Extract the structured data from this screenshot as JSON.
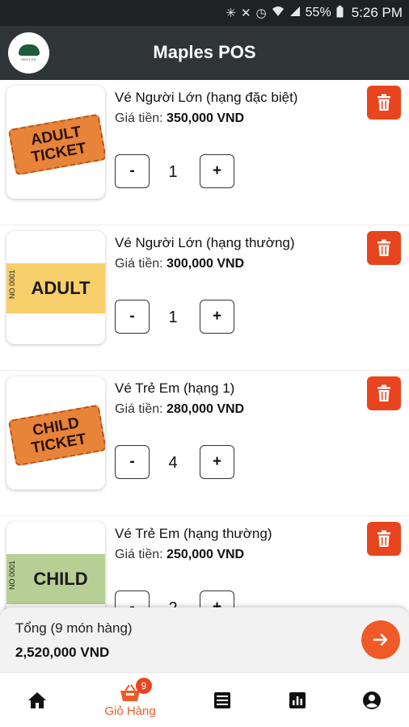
{
  "status_bar": {
    "battery": "55%",
    "time": "5:26 PM",
    "icons": [
      "bluetooth-icon",
      "mute-icon",
      "alarm-icon",
      "wifi-icon",
      "signal-icon",
      "battery-icon"
    ]
  },
  "header": {
    "title": "Maples POS",
    "logo": "maples-logo"
  },
  "cart": {
    "price_prefix": "Giá tiền:",
    "items": [
      {
        "name": "Vé Người Lớn (hạng đặc biệt)",
        "price": "350,000 VND",
        "quantity": "1",
        "image_text": [
          "ADULT",
          "TICKET"
        ],
        "image_style": "orange-ticket"
      },
      {
        "name": "Vé Người Lớn (hạng thường)",
        "price": "300,000 VND",
        "quantity": "1",
        "image_text": [
          "ADULT",
          "NO 0001"
        ],
        "image_style": "yellow-band"
      },
      {
        "name": "Vé Trẻ Em (hạng 1)",
        "price": "280,000 VND",
        "quantity": "4",
        "image_text": [
          "CHILD",
          "TICKET"
        ],
        "image_style": "orange-ticket"
      },
      {
        "name": "Vé Trẻ Em (hạng thường)",
        "price": "250,000 VND",
        "quantity": "2",
        "image_text": [
          "CHILD",
          "NO 0001"
        ],
        "image_style": "green-band"
      }
    ],
    "minus_label": "-",
    "plus_label": "+"
  },
  "total": {
    "label": "Tổng (9 món hàng)",
    "amount": "2,520,000 VND"
  },
  "bottom_nav": {
    "items": [
      {
        "icon": "home-icon",
        "label": ""
      },
      {
        "icon": "cart-icon",
        "label": "Giỏ Hàng",
        "badge": "9",
        "active": true
      },
      {
        "icon": "list-icon",
        "label": ""
      },
      {
        "icon": "chart-icon",
        "label": ""
      },
      {
        "icon": "account-icon",
        "label": ""
      }
    ]
  },
  "colors": {
    "accent": "#f05a28",
    "delete": "#e8451f",
    "header_bg": "#2f3437",
    "status_bg": "#1f2224",
    "adult_band": "#f6cf6a",
    "child_band": "#b7cf94",
    "ticket_orange": "#e8833a"
  }
}
